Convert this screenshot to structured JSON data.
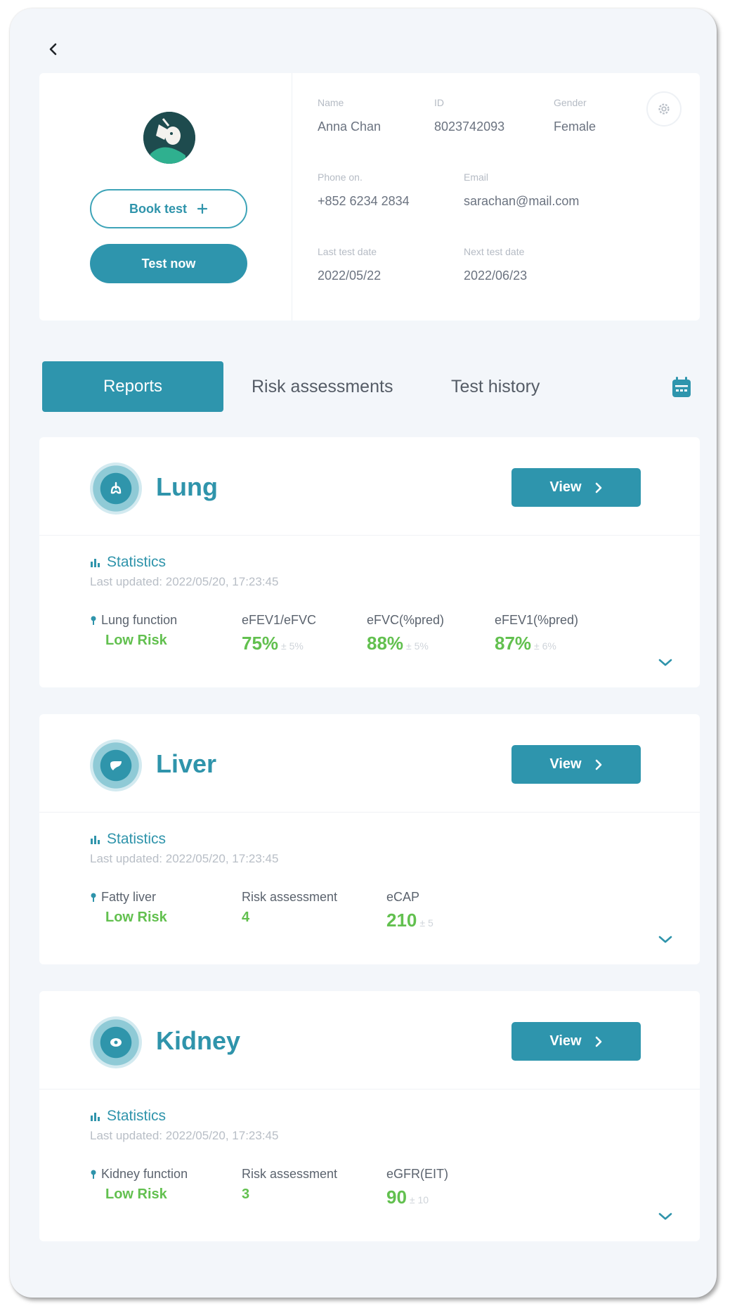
{
  "profile": {
    "book_test_label": "Book test",
    "test_now_label": "Test now",
    "fields": {
      "name_label": "Name",
      "name": "Anna Chan",
      "id_label": "ID",
      "id": "8023742093",
      "gender_label": "Gender",
      "gender": "Female",
      "phone_label": "Phone on.",
      "phone": "+852 6234 2834",
      "email_label": "Email",
      "email": "sarachan@mail.com",
      "last_test_label": "Last test date",
      "last_test": "2022/05/22",
      "next_test_label": "Next test date",
      "next_test": "2022/06/23"
    }
  },
  "tabs": [
    "Reports",
    "Risk assessments",
    "Test history"
  ],
  "reports": {
    "lung": {
      "title": "Lung",
      "view_label": "View",
      "stats_title": "Statistics",
      "updated": "Last updated: 2022/05/20, 17:23:45",
      "m1_label": "Lung function",
      "m1_value": "Low Risk",
      "m2_label": "eFEV1/eFVC",
      "m2_value": "75%",
      "m2_tol": "± 5%",
      "m3_label": "eFVC(%pred)",
      "m3_value": "88%",
      "m3_tol": "± 5%",
      "m4_label": "eFEV1(%pred)",
      "m4_value": "87%",
      "m4_tol": "± 6%"
    },
    "liver": {
      "title": "Liver",
      "view_label": "View",
      "stats_title": "Statistics",
      "updated": "Last updated: 2022/05/20, 17:23:45",
      "m1_label": "Fatty liver",
      "m1_value": "Low Risk",
      "m2_label": "Risk assessment",
      "m2_value": "4",
      "m3_label": "eCAP",
      "m3_value": "210",
      "m3_tol": "± 5"
    },
    "kidney": {
      "title": "Kidney",
      "view_label": "View",
      "stats_title": "Statistics",
      "updated": "Last updated: 2022/05/20, 17:23:45",
      "m1_label": "Kidney function",
      "m1_value": "Low Risk",
      "m2_label": "Risk assessment",
      "m2_value": "3",
      "m3_label": "eGFR(EIT)",
      "m3_value": "90",
      "m3_tol": "± 10"
    }
  },
  "colors": {
    "accent": "#2e95ad",
    "success": "#62c04f",
    "background": "#f3f6fa"
  },
  "icons": [
    "back-arrow-icon",
    "gear-icon",
    "plus-icon",
    "calendar-icon",
    "bar-chart-icon",
    "pin-icon",
    "chevron-right-icon",
    "chevron-down-icon",
    "lung-icon",
    "liver-icon",
    "kidney-icon"
  ]
}
